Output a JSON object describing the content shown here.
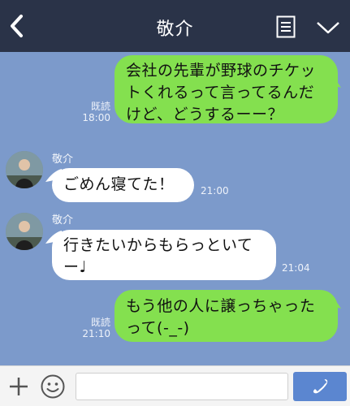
{
  "header": {
    "title": "敬介"
  },
  "messages": [
    {
      "from": "me",
      "text": "会社の先輩が野球のチケットくれるって言ってるんだけど、どうするーー？",
      "read": "既読",
      "time": "18:00"
    },
    {
      "from": "them",
      "sender": "敬介",
      "text": "ごめん寝てた！",
      "time": "21:00"
    },
    {
      "from": "them",
      "sender": "敬介",
      "text": "行きたいからもらっといてー♩",
      "time": "21:04"
    },
    {
      "from": "me",
      "text": "もう他の人に譲っちゃったって(-_-)",
      "read": "既読",
      "time": "21:10"
    }
  ],
  "footer": {
    "input_placeholder": ""
  },
  "colors": {
    "header_bg": "#2a3348",
    "chat_bg": "#7c9acb",
    "my_bubble": "#84e04f",
    "their_bubble": "#ffffff",
    "call_button": "#5b86d0"
  },
  "icons": {
    "back": "back-icon",
    "menu": "menu-icon",
    "collapse": "chevron-down-icon",
    "add": "plus-icon",
    "sticker": "smile-icon",
    "call": "phone-icon"
  }
}
